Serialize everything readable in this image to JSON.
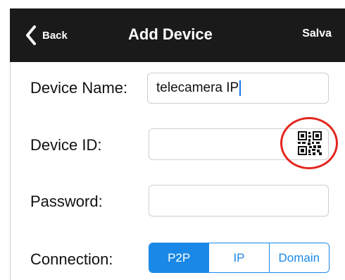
{
  "navbar": {
    "back_label": "Back",
    "title": "Add Device",
    "save_label": "Salva",
    "background": "#1a1a1a"
  },
  "form": {
    "device_name": {
      "label": "Device Name:",
      "value": "telecamera IP"
    },
    "device_id": {
      "label": "Device ID:",
      "value": "",
      "qr_icon": "qr-code-icon",
      "highlight_color": "#e3261f"
    },
    "password": {
      "label": "Password:",
      "value": ""
    },
    "connection": {
      "label": "Connection:",
      "options": [
        "P2P",
        "IP",
        "Domain"
      ],
      "selected": "P2P",
      "accent": "#1a88e6"
    }
  }
}
